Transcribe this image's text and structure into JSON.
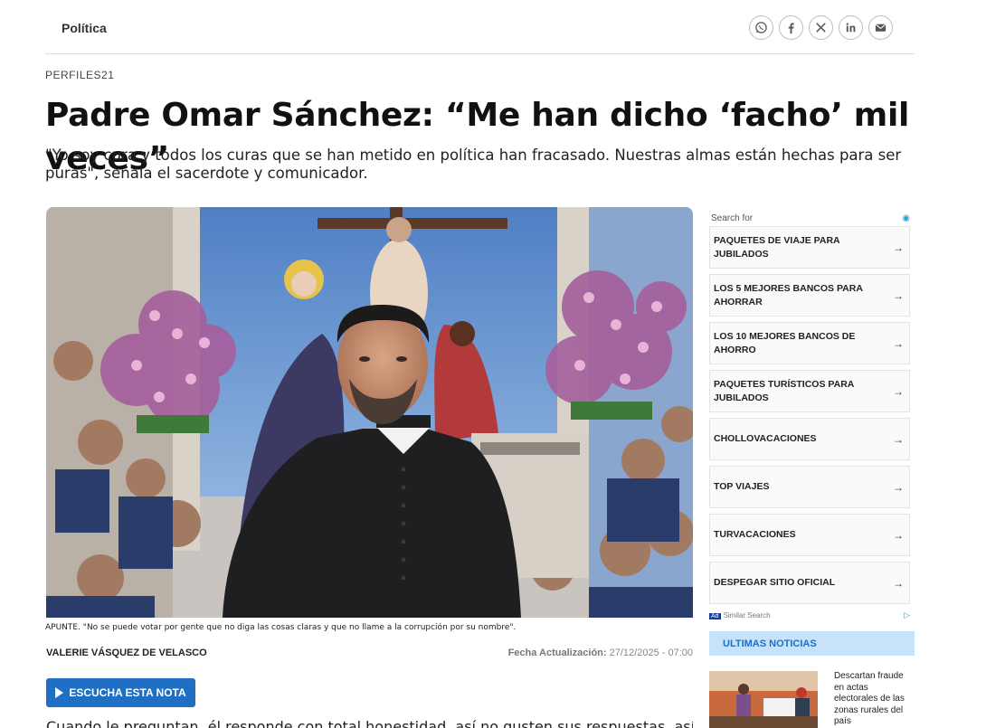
{
  "header": {
    "section": "Política"
  },
  "share": [
    "whatsapp-icon",
    "facebook-icon",
    "x-icon",
    "linkedin-icon",
    "mail-icon"
  ],
  "article": {
    "kicker": "PERFILES21",
    "headline": "Padre Omar Sánchez: “Me han dicho ‘facho’ mil veces”",
    "deck": "\"Yo soy cura y todos los curas que se han metido en política han fracasado. Nuestras almas están hechas para ser puras\", señala el sacerdote y comunicador.",
    "caption": "APUNTE. \"No se puede votar por gente que no diga las cosas claras y que no llame a la corrupción por su nombre\".",
    "author": "VALERIE VÁSQUEZ DE VELASCO",
    "updated_label": "Fecha Actualización:",
    "updated_value": "27/12/2025 - 07:00",
    "listen_label": "ESCUCHA ESTA NOTA",
    "body_start": "Cuando le preguntan, él responde con total honestidad, así no gusten sus respuestas, así caiga en"
  },
  "ad": {
    "header": "Search for",
    "items": [
      "PAQUETES DE VIAJE PARA JUBILADOS",
      "LOS 5 MEJORES BANCOS PARA AHORRAR",
      "LOS 10 MEJORES BANCOS DE AHORRO",
      "PAQUETES TURÍSTICOS PARA JUBILADOS",
      "CHOLLOVACACIONES",
      "TOP VIAJES",
      "TURVACACIONES",
      "DESPEGAR SITIO OFICIAL"
    ],
    "footer_badge": "Ad",
    "footer": "Similar Search"
  },
  "news": {
    "title": "ULTIMAS NOTICIAS",
    "item": "Descartan fraude en actas electorales de las zonas rurales del país"
  },
  "colors": {
    "accent": "#1f6fc5",
    "news_header_bg": "#c8e3f7"
  }
}
